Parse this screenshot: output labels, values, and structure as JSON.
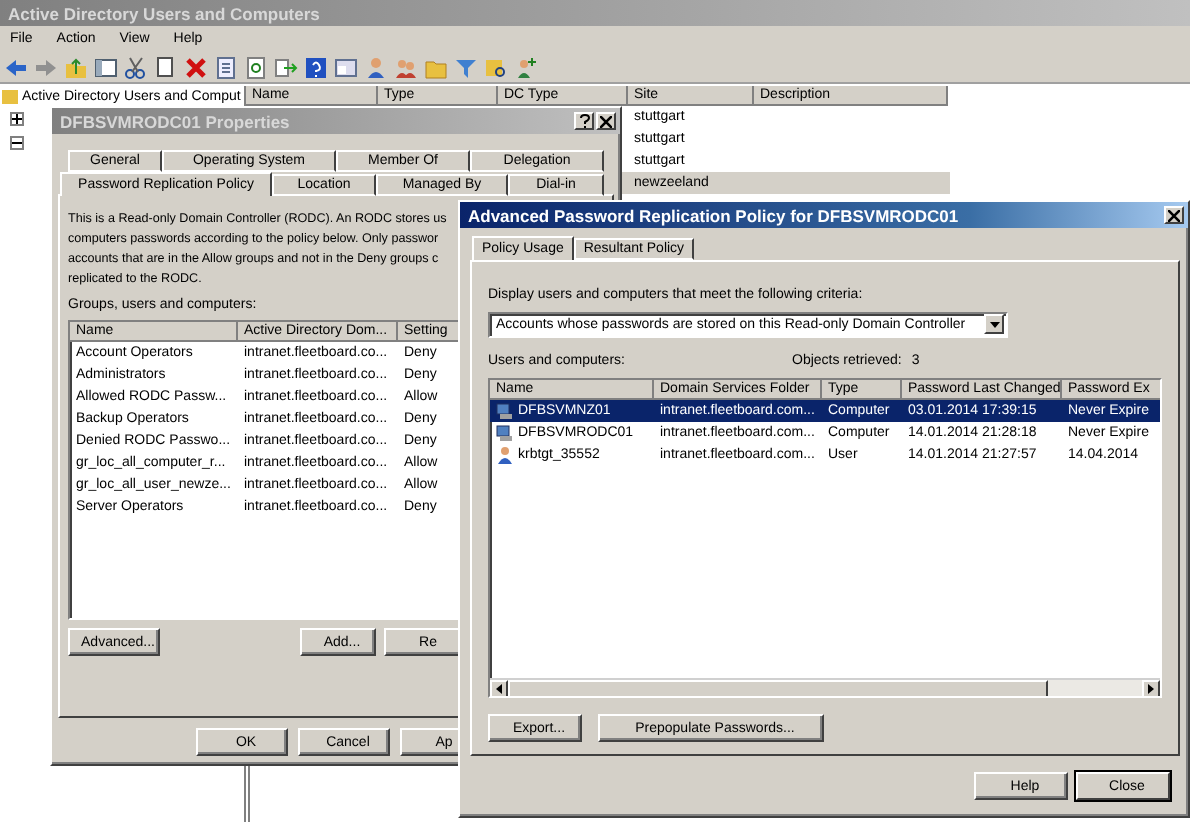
{
  "main_window": {
    "title": "Active Directory Users and Computers",
    "menu": [
      "File",
      "Action",
      "View",
      "Help"
    ],
    "tree": {
      "header": "Active Directory Users and Comput",
      "expanders": [
        {
          "expanded": false
        },
        {
          "expanded": true
        }
      ]
    },
    "list": {
      "columns": [
        "Name",
        "Type",
        "DC Type",
        "Site",
        "Description"
      ],
      "rows": [
        {
          "site": "stuttgart",
          "selected": false
        },
        {
          "site": "stuttgart",
          "selected": false
        },
        {
          "site": "stuttgart",
          "selected": false
        },
        {
          "site": "newzeeland",
          "selected": true
        }
      ]
    }
  },
  "properties_dialog": {
    "title": "DFBSVMRODC01 Properties",
    "tab_rows": [
      [
        {
          "label": "General",
          "selected": false
        },
        {
          "label": "Operating System",
          "selected": false
        },
        {
          "label": "Member Of",
          "selected": false
        },
        {
          "label": "Delegation",
          "selected": false
        }
      ],
      [
        {
          "label": "Password Replication Policy",
          "selected": true
        },
        {
          "label": "Location",
          "selected": false
        },
        {
          "label": "Managed By",
          "selected": false
        },
        {
          "label": "Dial-in",
          "selected": false
        }
      ]
    ],
    "intro_lines": [
      "This is a Read-only Domain Controller (RODC).  An RODC stores us",
      "computers passwords according to the policy below.  Only passwor",
      "accounts that are in the Allow groups and not in the Deny groups c",
      "replicated to the RODC."
    ],
    "list_label": "Groups, users and computers:",
    "columns": [
      "Name",
      "Active Directory Dom...",
      "Setting"
    ],
    "rows": [
      {
        "name": "Account Operators",
        "domain": "intranet.fleetboard.co...",
        "setting": "Deny"
      },
      {
        "name": "Administrators",
        "domain": "intranet.fleetboard.co...",
        "setting": "Deny"
      },
      {
        "name": "Allowed RODC Passw...",
        "domain": "intranet.fleetboard.co...",
        "setting": "Allow"
      },
      {
        "name": "Backup Operators",
        "domain": "intranet.fleetboard.co...",
        "setting": "Deny"
      },
      {
        "name": "Denied RODC Passwo...",
        "domain": "intranet.fleetboard.co...",
        "setting": "Deny"
      },
      {
        "name": "gr_loc_all_computer_r...",
        "domain": "intranet.fleetboard.co...",
        "setting": "Allow"
      },
      {
        "name": "gr_loc_all_user_newze...",
        "domain": "intranet.fleetboard.co...",
        "setting": "Allow"
      },
      {
        "name": "Server Operators",
        "domain": "intranet.fleetboard.co...",
        "setting": "Deny"
      }
    ],
    "buttons": [
      "Advanced...",
      "Add...",
      "Re"
    ],
    "footer_buttons": [
      "OK",
      "Cancel",
      "Ap"
    ]
  },
  "advanced_dialog": {
    "title": "Advanced Password Replication Policy for DFBSVMRODC01",
    "tabs": [
      {
        "label": "Policy Usage",
        "selected": true
      },
      {
        "label": "Resultant Policy",
        "selected": false
      }
    ],
    "criteria_label": "Display users and computers that meet the following criteria:",
    "criteria": "Accounts whose passwords are stored on this Read-only Domain Controller",
    "list_label": "Users and computers:",
    "retrieved_label": "Objects retrieved:",
    "retrieved_count": "3",
    "columns": [
      "Name",
      "Domain Services Folder",
      "Type",
      "Password Last Changed",
      "Password Ex"
    ],
    "rows": [
      {
        "kind": "computer",
        "name": "DFBSVMNZ01",
        "folder": "intranet.fleetboard.com...",
        "type": "Computer",
        "changed": "03.01.2014 17:39:15",
        "expires": "Never Expire",
        "selected": true
      },
      {
        "kind": "computer",
        "name": "DFBSVMRODC01",
        "folder": "intranet.fleetboard.com...",
        "type": "Computer",
        "changed": "14.01.2014 21:28:18",
        "expires": "Never Expire",
        "selected": false
      },
      {
        "kind": "user",
        "name": "krbtgt_35552",
        "folder": "intranet.fleetboard.com...",
        "type": "User",
        "changed": "14.01.2014 21:27:57",
        "expires": "14.04.2014",
        "selected": false
      }
    ],
    "buttons": [
      "Export...",
      "Prepopulate Passwords..."
    ],
    "footer_buttons": [
      "Help",
      "Close"
    ]
  }
}
